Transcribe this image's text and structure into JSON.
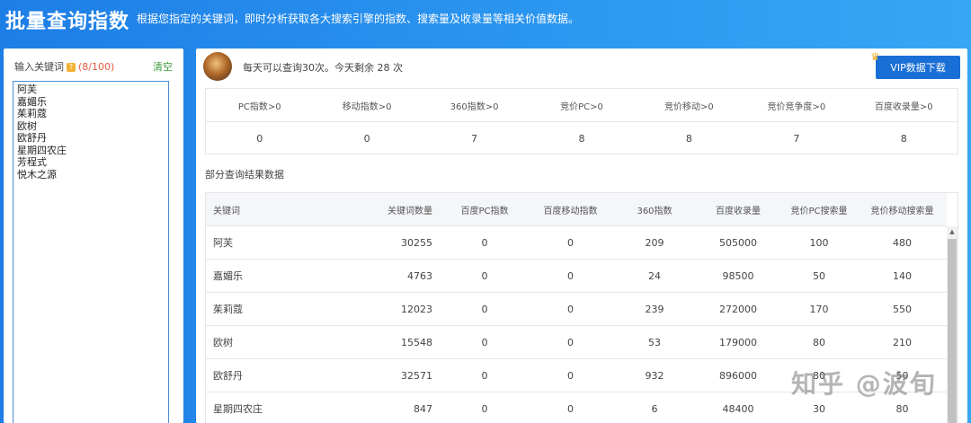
{
  "header": {
    "title": "批量查询指数",
    "subtitle": "根据您指定的关键词，即时分析获取各大搜索引擎的指数、搜索量及收录量等相关价值数据。"
  },
  "input_panel": {
    "label": "输入关键词",
    "help_icon": "question-icon",
    "count": "(8/100)",
    "clear_label": "清空",
    "keywords": [
      "阿芙",
      "嘉媚乐",
      "茱莉蔻",
      "欧树",
      "欧舒丹",
      "星期四农庄",
      "芳程式",
      "悦木之源"
    ]
  },
  "user_bar": {
    "quota_text": "每天可以查询30次。今天剩余 28 次",
    "vip_label": "VIP数据下载",
    "crown_icon": "crown-icon"
  },
  "stats": {
    "headers": [
      "PC指数>0",
      "移动指数>0",
      "360指数>0",
      "竞价PC>0",
      "竞价移动>0",
      "竞价竞争度>0",
      "百度收录量>0"
    ],
    "values": [
      "0",
      "0",
      "7",
      "8",
      "8",
      "7",
      "8"
    ]
  },
  "results": {
    "section_title": "部分查询结果数据",
    "columns": [
      "关键词",
      "关键词数量",
      "百度PC指数",
      "百度移动指数",
      "360指数",
      "百度收录量",
      "竞价PC搜索量",
      "竞价移动搜索量"
    ],
    "rows": [
      [
        "阿芙",
        "30255",
        "0",
        "0",
        "209",
        "505000",
        "100",
        "480"
      ],
      [
        "嘉媚乐",
        "4763",
        "0",
        "0",
        "24",
        "98500",
        "50",
        "140"
      ],
      [
        "茱莉蔻",
        "12023",
        "0",
        "0",
        "239",
        "272000",
        "170",
        "550"
      ],
      [
        "欧树",
        "15548",
        "0",
        "0",
        "53",
        "179000",
        "80",
        "210"
      ],
      [
        "欧舒丹",
        "32571",
        "0",
        "0",
        "932",
        "896000",
        "80",
        "50"
      ],
      [
        "星期四农庄",
        "847",
        "0",
        "0",
        "6",
        "48400",
        "30",
        "80"
      ]
    ]
  },
  "watermark": "知乎 @波旬"
}
